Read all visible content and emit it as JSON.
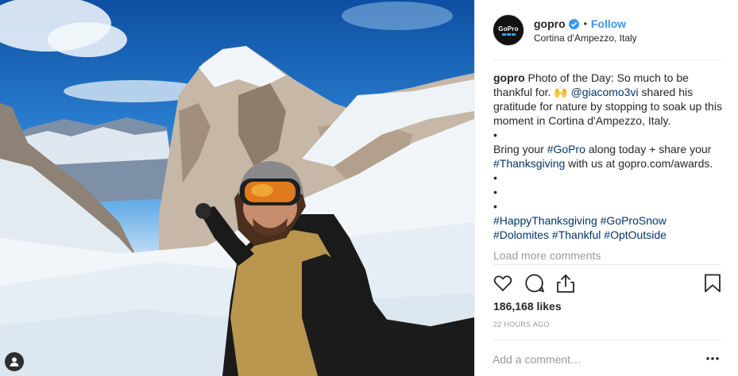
{
  "post": {
    "username": "gopro",
    "follow_label": "Follow",
    "dot": "•",
    "location": "Cortina d'Ampezzo, Italy",
    "avatar_text": "GoPro",
    "colors": {
      "accent": "#3897f0",
      "link": "#003569",
      "muted": "#999999"
    }
  },
  "caption": {
    "username": "gopro",
    "text_1": " Photo of the Day: So much to be thankful for. 🙌 ",
    "mention": "@giacomo3vi",
    "text_2": " shared his gratitude for nature by stopping to soak up this moment in Cortina d'Ampezzo, Italy.",
    "bullet": "•",
    "text_3": "Bring your ",
    "tag_gopro": "#GoPro",
    "text_4": " along today + share your ",
    "tag_thanksgiving": "#Thanksgiving",
    "text_5": " with us at gopro.com/awards.",
    "hashtags": [
      "#HappyThanksgiving",
      "#GoProSnow",
      "#Dolomites",
      "#Thankful",
      "#OptOutside"
    ]
  },
  "comments": {
    "load_more_label": "Load more comments"
  },
  "actions": {
    "icons": [
      "heart-icon",
      "comment-icon",
      "share-icon",
      "bookmark-icon"
    ]
  },
  "stats": {
    "likes": "186,168 likes",
    "time": "22 HOURS AGO"
  },
  "comment_input": {
    "placeholder": "Add a comment…",
    "value": ""
  },
  "more_icon": "more-options-icon"
}
